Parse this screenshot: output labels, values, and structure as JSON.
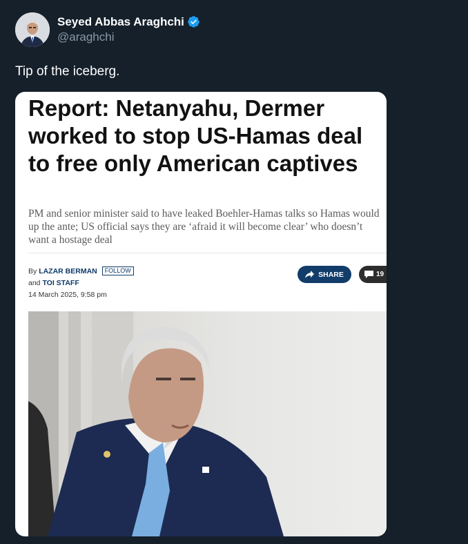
{
  "user": {
    "display_name": "Seyed Abbas Araghchi",
    "handle": "@araghchi",
    "verified_icon": "verified-badge-icon",
    "verified_color": "#1d9bf0"
  },
  "tweet": {
    "text": "Tip of the iceberg."
  },
  "article": {
    "headline": "Report: Netanyahu, Dermer worked to stop US-Hamas deal to free only American captives",
    "subhead": "PM and senior minister said to have leaked Boehler-Hamas talks so Hamas would up the ante; US official says they are ‘afraid it will become clear’ who doesn’t want a hostage deal",
    "byline_prefix": "By",
    "author1": "LAZAR BERMAN",
    "follow_label": "FOLLOW",
    "byline_and": "and",
    "author2": "TOI STAFF",
    "date": "14 March 2025, 9:58 pm",
    "share_label": "SHARE",
    "comments_count": "19",
    "share_color": "#123c69"
  },
  "colors": {
    "background": "#15202b",
    "card": "#ffffff"
  }
}
